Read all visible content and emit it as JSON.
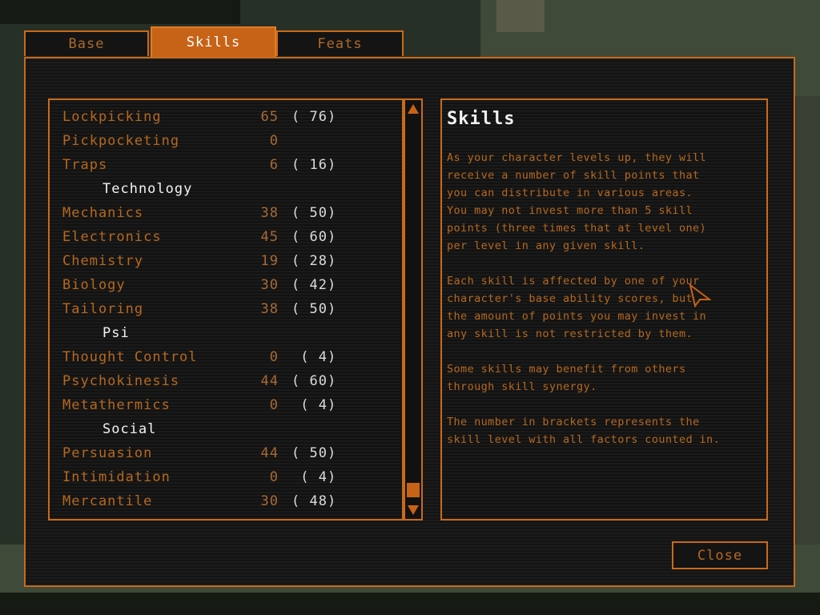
{
  "tabs": [
    {
      "label": "Base",
      "active": false
    },
    {
      "label": "Skills",
      "active": true
    },
    {
      "label": "Feats",
      "active": false
    }
  ],
  "skills_list": [
    {
      "type": "skill",
      "name": "Lockpicking",
      "value": "65",
      "total": "( 76)"
    },
    {
      "type": "skill",
      "name": "Pickpocketing",
      "value": "0",
      "total": ""
    },
    {
      "type": "skill",
      "name": "Traps",
      "value": "6",
      "total": "( 16)"
    },
    {
      "type": "category",
      "name": "Technology"
    },
    {
      "type": "skill",
      "name": "Mechanics",
      "value": "38",
      "total": "( 50)"
    },
    {
      "type": "skill",
      "name": "Electronics",
      "value": "45",
      "total": "( 60)"
    },
    {
      "type": "skill",
      "name": "Chemistry",
      "value": "19",
      "total": "( 28)"
    },
    {
      "type": "skill",
      "name": "Biology",
      "value": "30",
      "total": "( 42)"
    },
    {
      "type": "skill",
      "name": "Tailoring",
      "value": "38",
      "total": "( 50)"
    },
    {
      "type": "category",
      "name": "Psi"
    },
    {
      "type": "skill",
      "name": "Thought Control",
      "value": "0",
      "total": " ( 4)"
    },
    {
      "type": "skill",
      "name": "Psychokinesis",
      "value": "44",
      "total": "( 60)"
    },
    {
      "type": "skill",
      "name": "Metathermics",
      "value": "0",
      "total": " ( 4)"
    },
    {
      "type": "category",
      "name": "Social"
    },
    {
      "type": "skill",
      "name": "Persuasion",
      "value": "44",
      "total": "( 50)"
    },
    {
      "type": "skill",
      "name": "Intimidation",
      "value": "0",
      "total": " ( 4)"
    },
    {
      "type": "skill",
      "name": "Mercantile",
      "value": "30",
      "total": "( 48)"
    }
  ],
  "description": {
    "title": "Skills",
    "paragraphs": [
      "As your character levels up, they will\nreceive a number of skill points that\nyou can distribute in various areas.\nYou may not invest more than 5 skill\npoints (three times that at level one)\nper level in any given skill.",
      "Each skill is affected by one of your\ncharacter's base ability scores, but\nthe amount of points you may invest in\nany skill is not restricted by them.",
      "Some skills may benefit from others\nthrough skill synergy.",
      "The number in brackets represents the\nskill level with all factors counted in."
    ]
  },
  "buttons": {
    "close": "Close"
  },
  "colors": {
    "accent": "#c96a1b",
    "skill_text": "#b5681f",
    "category_text": "#f2f2f2"
  }
}
